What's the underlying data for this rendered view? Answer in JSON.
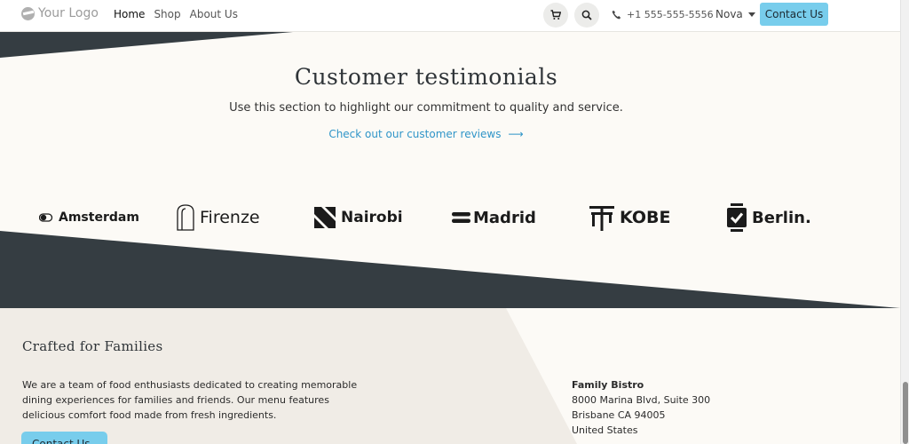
{
  "header": {
    "logo_text": "Your Logo",
    "nav": [
      {
        "label": "Home",
        "active": true
      },
      {
        "label": "Shop",
        "active": false
      },
      {
        "label": "About Us",
        "active": false
      }
    ],
    "phone": "+1 555-555-5556",
    "language": "Nova",
    "contact_label": "Contact Us",
    "icons": [
      "cart-icon",
      "search-icon",
      "phone-icon",
      "chevron-down-icon"
    ]
  },
  "testimonials": {
    "title": "Customer testimonials",
    "subtitle": "Use this section to highlight our commitment to quality and service.",
    "link_label": "Check out our customer reviews"
  },
  "brands": [
    "Amsterdam",
    "Firenze",
    "Nairobi",
    "Madrid",
    "KOBE",
    "Berlin."
  ],
  "footer": {
    "title": "Crafted for Families",
    "description": "We are a team of food enthusiasts dedicated to creating memorable dining experiences for families and friends. Our menu features delicious comfort food made from fresh ingredients.",
    "button_label": "Contact Us",
    "address": {
      "name": "Family Bistro",
      "line1": "8000 Marina Blvd, Suite 300",
      "line2": "Brisbane CA 94005",
      "line3": "United States"
    }
  },
  "colors": {
    "accent": "#78cdec",
    "dark": "#353d42",
    "cream": "#fcfaf6",
    "beige": "#f0ece6",
    "link": "#2f95c8"
  }
}
